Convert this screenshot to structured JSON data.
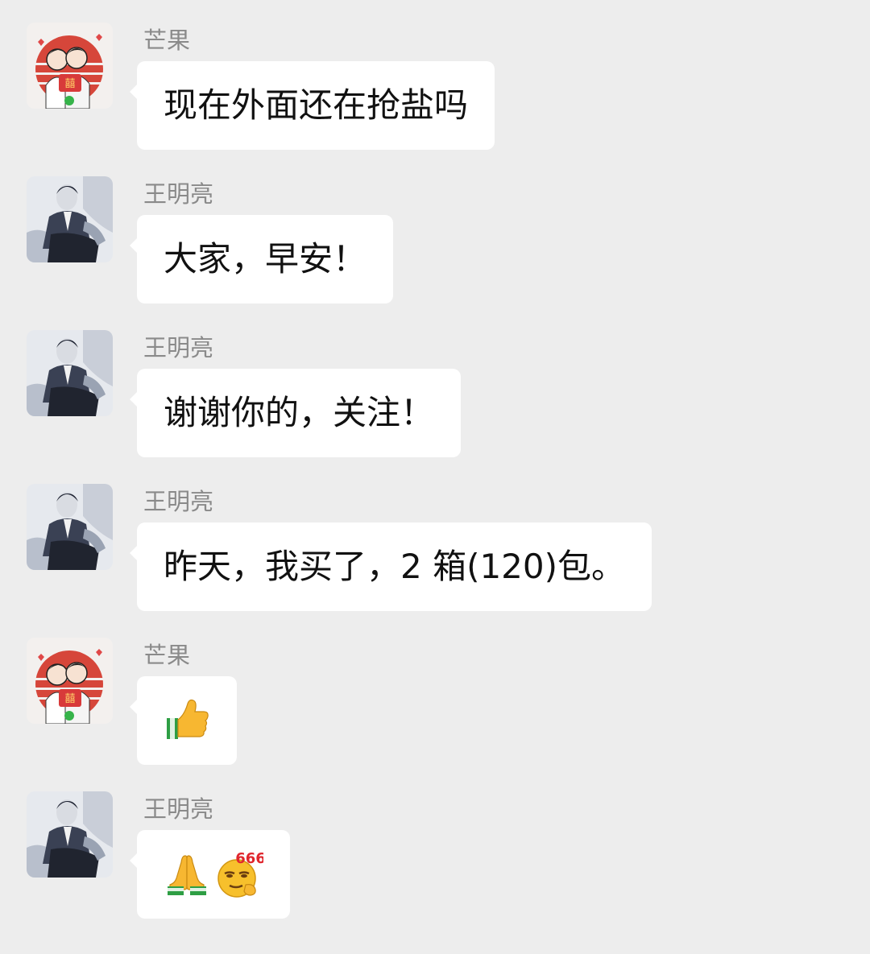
{
  "messages": [
    {
      "sender": "芒果",
      "avatar": "couple-avatar-icon",
      "type": "text",
      "text": "现在外面还在抢盐吗"
    },
    {
      "sender": "王明亮",
      "avatar": "man-photo-avatar-icon",
      "type": "text",
      "text": "大家，早安！"
    },
    {
      "sender": "王明亮",
      "avatar": "man-photo-avatar-icon",
      "type": "text",
      "text": "谢谢你的，关注！"
    },
    {
      "sender": "王明亮",
      "avatar": "man-photo-avatar-icon",
      "type": "text",
      "text": "昨天，我买了，2 箱(120)包。"
    },
    {
      "sender": "芒果",
      "avatar": "couple-avatar-icon",
      "type": "emoji",
      "emojis": [
        "thumbs-up-icon"
      ]
    },
    {
      "sender": "王明亮",
      "avatar": "man-photo-avatar-icon",
      "type": "emoji",
      "emojis": [
        "praying-hands-icon",
        "smirk-666-icon"
      ],
      "emoji_text": "666"
    }
  ],
  "colors": {
    "background": "#ededed",
    "bubble": "#ffffff",
    "sender_name": "#8a8a8a",
    "text": "#111111"
  }
}
